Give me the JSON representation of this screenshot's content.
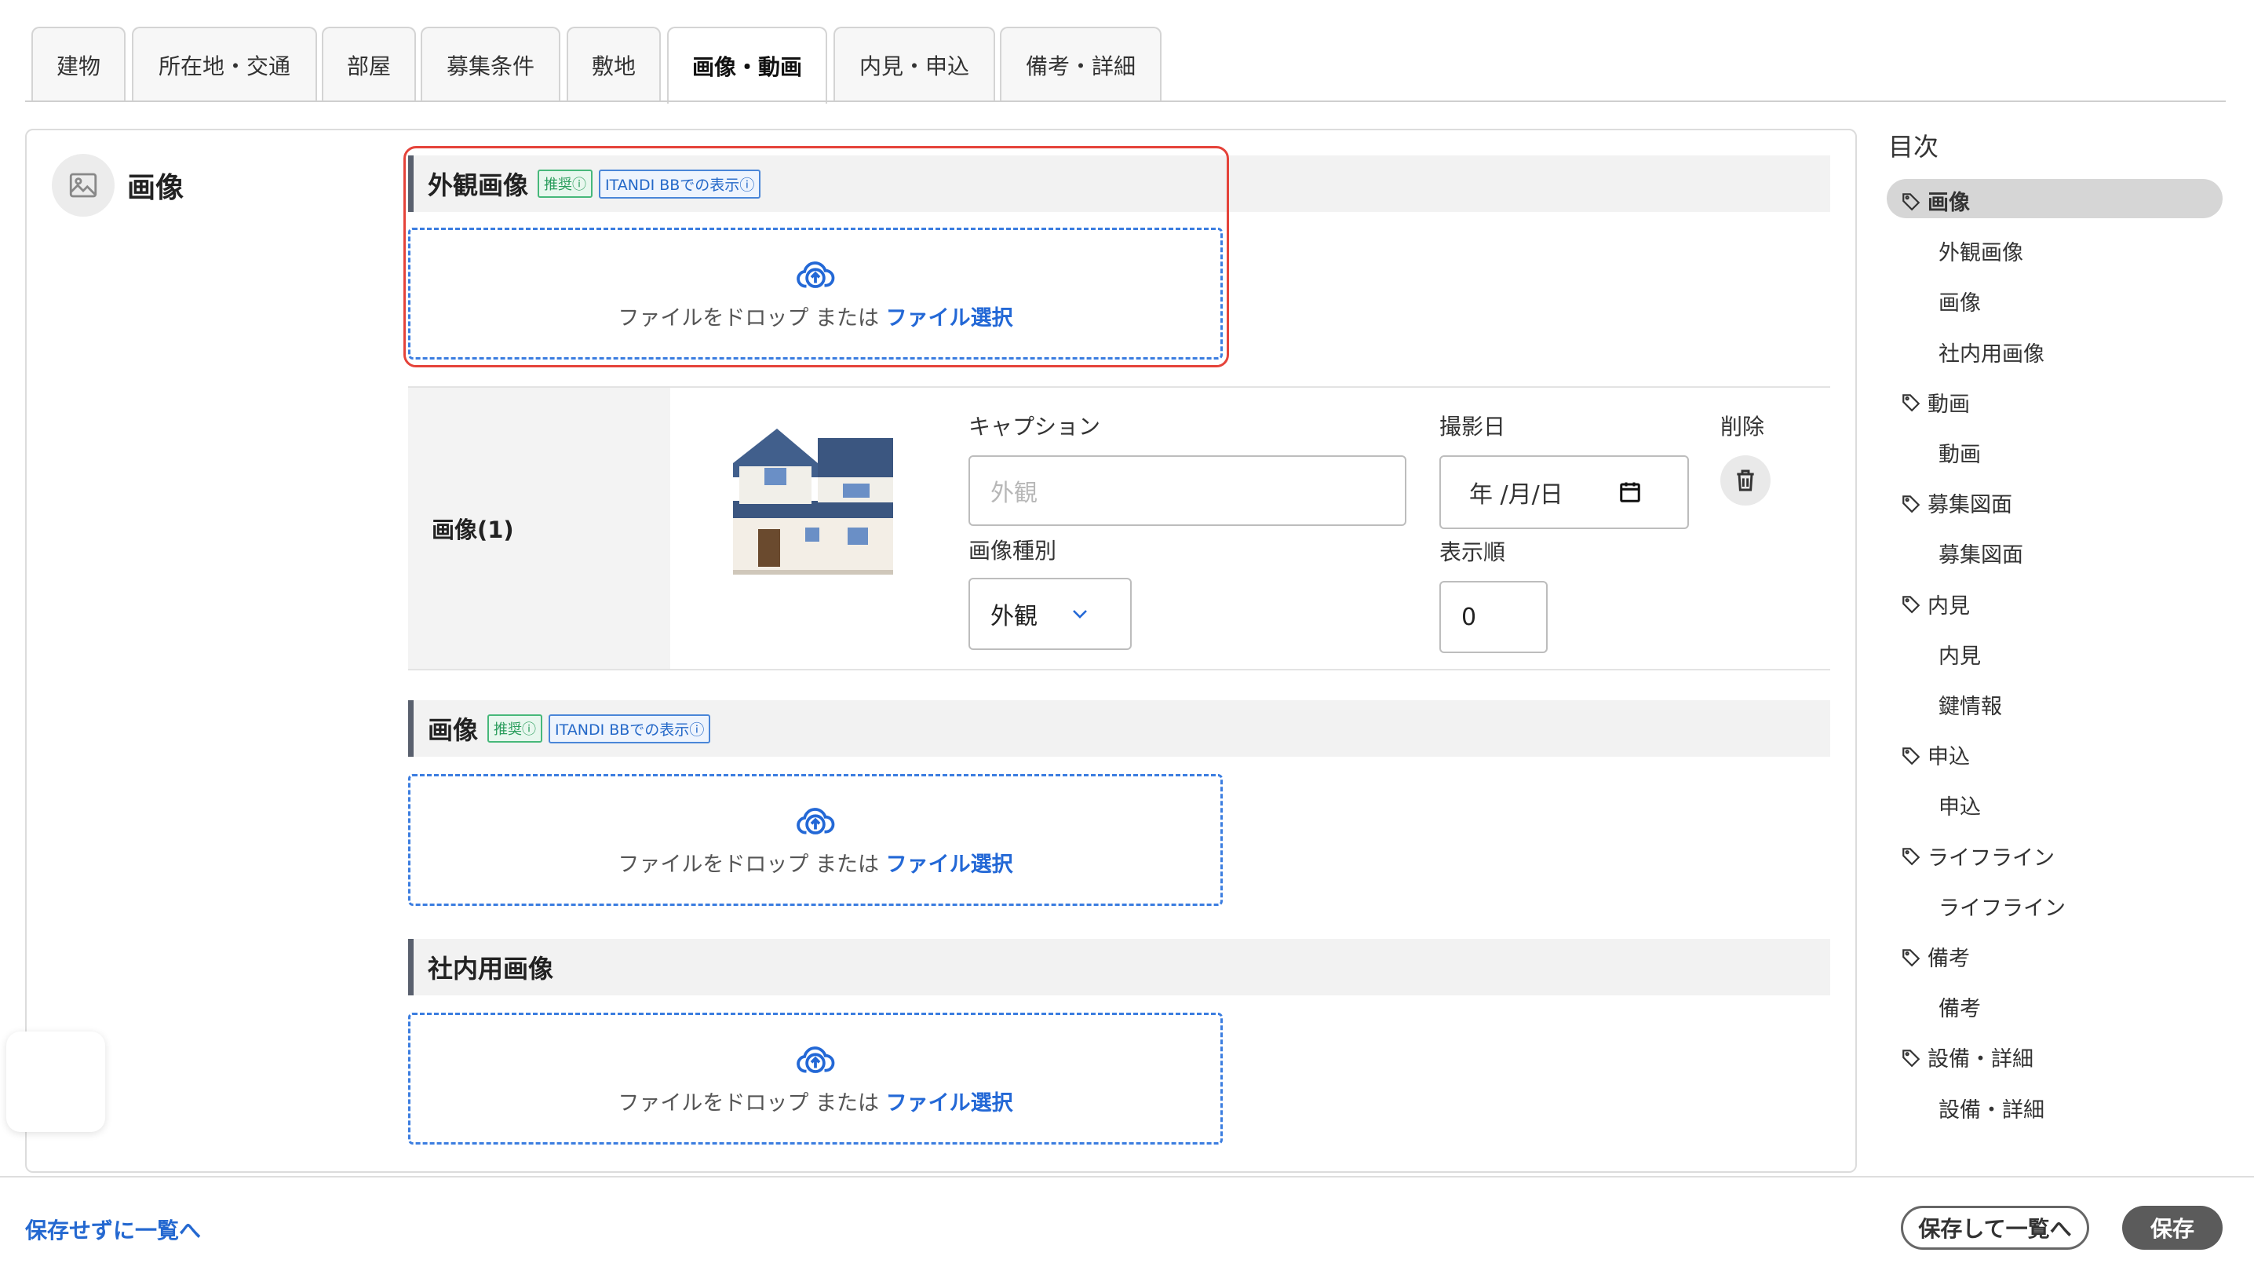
{
  "tabs": [
    {
      "label": "建物"
    },
    {
      "label": "所在地・交通"
    },
    {
      "label": "部屋"
    },
    {
      "label": "募集条件"
    },
    {
      "label": "敷地"
    },
    {
      "label": "画像・動画"
    },
    {
      "label": "内見・申込"
    },
    {
      "label": "備考・詳細"
    }
  ],
  "active_tab": "画像・動画",
  "section": {
    "title": "画像",
    "icon": "image-icon"
  },
  "exterior": {
    "title": "外観画像",
    "badge_recommend": "推奨",
    "badge_itandi": "ITANDI BBでの表示",
    "drop_text": "ファイルをドロップ または",
    "drop_link": "ファイル選択"
  },
  "image_row": {
    "label": "画像(1)",
    "caption_label": "キャプション",
    "caption_placeholder": "外観",
    "date_label": "撮影日",
    "date_placeholder": "年 /月/日",
    "delete_label": "削除",
    "type_label": "画像種別",
    "type_value": "外観",
    "order_label": "表示順",
    "order_value": "0"
  },
  "images": {
    "title": "画像",
    "badge_recommend": "推奨",
    "badge_itandi": "ITANDI BBでの表示",
    "drop_text": "ファイルをドロップ または",
    "drop_link": "ファイル選択"
  },
  "internal": {
    "title": "社内用画像",
    "drop_text": "ファイルをドロップ または",
    "drop_link": "ファイル選択"
  },
  "toc": {
    "title": "目次",
    "items": [
      {
        "label": "画像",
        "level": 1
      },
      {
        "label": "外観画像",
        "level": 2
      },
      {
        "label": "画像",
        "level": 2
      },
      {
        "label": "社内用画像",
        "level": 2
      },
      {
        "label": "動画",
        "level": 1
      },
      {
        "label": "動画",
        "level": 2
      },
      {
        "label": "募集図面",
        "level": 1
      },
      {
        "label": "募集図面",
        "level": 2
      },
      {
        "label": "内見",
        "level": 1
      },
      {
        "label": "内見",
        "level": 2
      },
      {
        "label": "鍵情報",
        "level": 2
      },
      {
        "label": "申込",
        "level": 1
      },
      {
        "label": "申込",
        "level": 2
      },
      {
        "label": "ライフライン",
        "level": 1
      },
      {
        "label": "ライフライン",
        "level": 2
      },
      {
        "label": "備考",
        "level": 1
      },
      {
        "label": "備考",
        "level": 2
      },
      {
        "label": "設備・詳細",
        "level": 1
      },
      {
        "label": "設備・詳細",
        "level": 2
      }
    ]
  },
  "footer": {
    "back_link": "保存せずに一覧へ",
    "save_and_list": "保存して一覧へ",
    "save": "保存"
  },
  "colors": {
    "accent": "#2368d6",
    "highlight": "#e5433a",
    "primary_button": "#5b5b5b"
  }
}
